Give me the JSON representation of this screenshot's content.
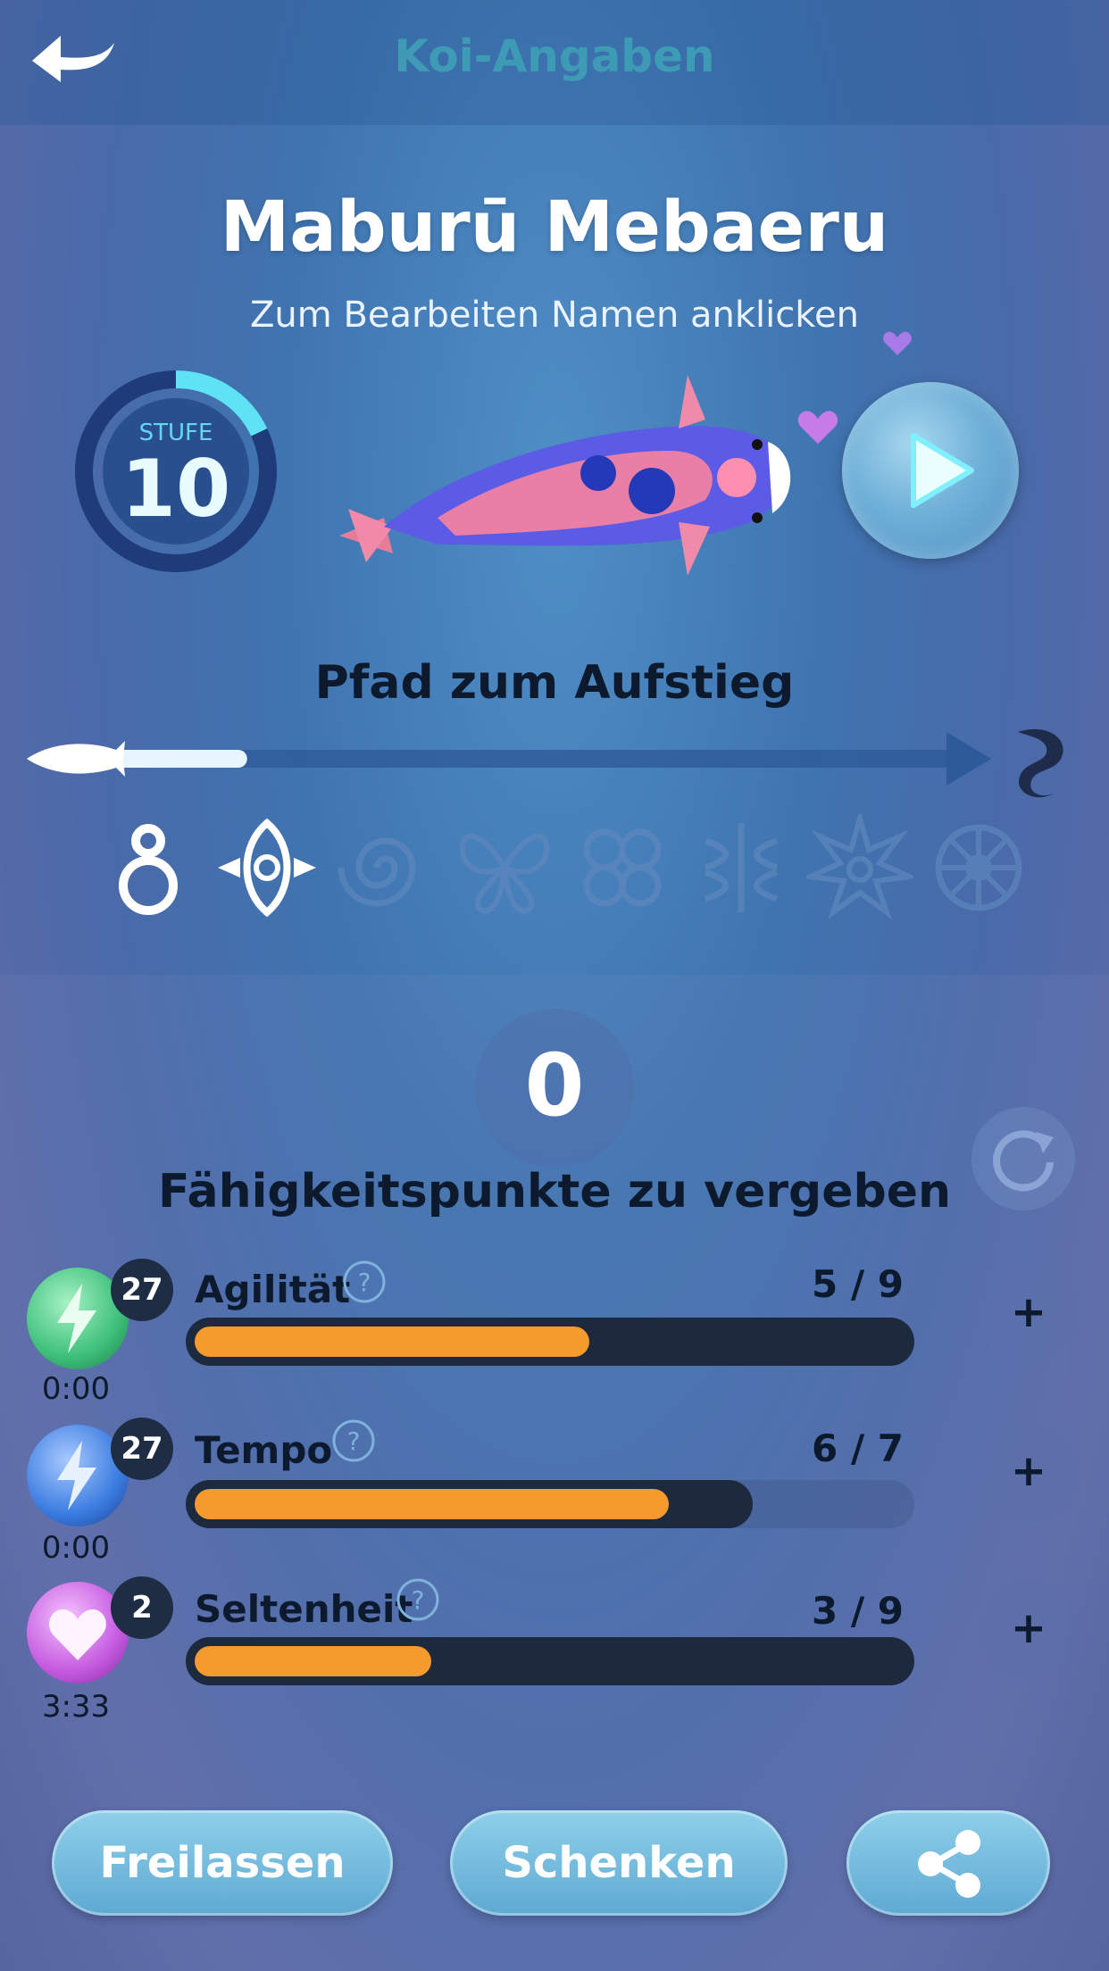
{
  "header": {
    "title": "Koi-Angaben"
  },
  "koi": {
    "name": "Maburū Mebaeru",
    "hint": "Zum Bearbeiten Namen anklicken"
  },
  "level": {
    "label": "STUFE",
    "value": "10",
    "progress": 0.18
  },
  "path": {
    "title": "Pfad zum Aufstieg",
    "progress": 0.16,
    "unlocked_symbols": 2,
    "symbols": [
      "ring-symbol",
      "lotus-symbol",
      "spiral-symbol",
      "butterfly-symbol",
      "clover-symbol",
      "flower-symbol",
      "sun-symbol",
      "wheel-symbol"
    ]
  },
  "skills": {
    "points": "0",
    "points_label": "Fähigkeitspunkte zu vergeben"
  },
  "stats": [
    {
      "name": "Agilität",
      "count": "27",
      "timer": "0:00",
      "value": "5 / 9",
      "current": 5,
      "max": 9,
      "cap": 9,
      "icon": "lightning-icon",
      "color": "#3dbf7a"
    },
    {
      "name": "Tempo",
      "count": "27",
      "timer": "0:00",
      "value": "6 / 7",
      "current": 6,
      "max": 7,
      "cap": 9,
      "icon": "lightning-icon",
      "color": "#3a7ce0"
    },
    {
      "name": "Seltenheit",
      "count": "2",
      "timer": "3:33",
      "value": "3 / 9",
      "current": 3,
      "max": 9,
      "cap": 9,
      "icon": "heart-icon",
      "color": "#c65ae0"
    }
  ],
  "buttons": {
    "release": "Freilassen",
    "gift": "Schenken",
    "share": "share-icon"
  },
  "colors": {
    "bar_fill": "#f59a2c",
    "bar_dark": "#1d2a3e",
    "title_teal": "#3fa3b8"
  }
}
